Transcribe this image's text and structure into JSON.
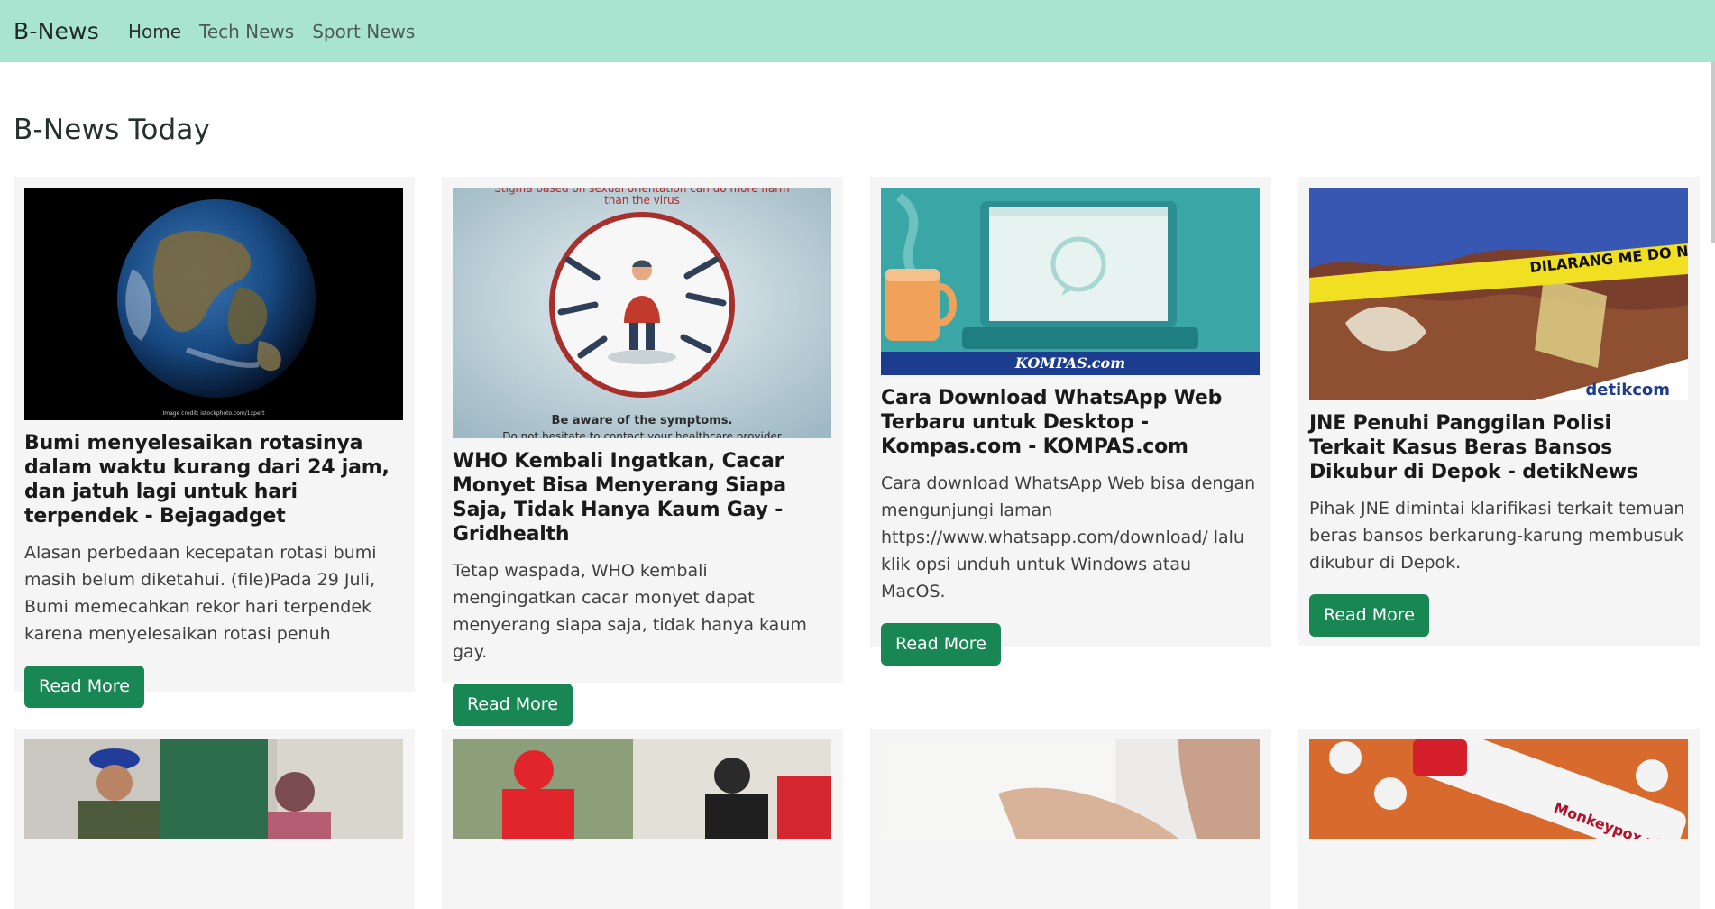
{
  "nav": {
    "brand": "B-News",
    "links": [
      "Home",
      "Tech News",
      "Sport News"
    ]
  },
  "heading": "B-News Today",
  "articles": [
    {
      "title": "Bumi menyelesaikan rotasinya dalam waktu kurang dari 24 jam, dan jatuh lagi untuk hari terpendek - Bejagadget",
      "description": "Alasan perbedaan kecepatan rotasi bumi masih belum diketahui. (file)Pada 29 Juli, Bumi memecahkan rekor hari terpendek karena menyelesaikan rotasi penuh",
      "button": "Read More",
      "image_caption": "Image credit: istockphoto.com/1xpert"
    },
    {
      "title": "WHO Kembali Ingatkan, Cacar Monyet Bisa Menyerang Siapa Saja, Tidak Hanya Kaum Gay - Gridhealth",
      "description": "Tetap waspada, WHO kembali mengingatkan cacar monyet dapat menyerang siapa saja, tidak hanya kaum gay.",
      "button": "Read More",
      "image_top_text": "Stigma based on sexual orientation can do more harm than the virus",
      "image_bottom_text": "Be aware of the symptoms.",
      "image_bottom_text2": "Do not hesitate to contact your healthcare provider"
    },
    {
      "title": "Cara Download WhatsApp Web Terbaru untuk Desktop - Kompas.com - KOMPAS.com",
      "description": "Cara download WhatsApp Web bisa dengan mengunjungi laman https://www.whatsapp.com/download/ lalu klik opsi unduh untuk Windows atau MacOS.",
      "button": "Read More",
      "image_logo": "KOMPAS.com"
    },
    {
      "title": "JNE Penuhi Panggilan Polisi Terkait Kasus Beras Bansos Dikubur di Depok - detikNews",
      "description": "Pihak JNE dimintai klarifikasi terkait temuan beras bansos berkarung-karung membusuk dikubur di Depok.",
      "button": "Read More",
      "image_tape": "DILARANG ME  DO NOT CR",
      "image_logo": "detikcom"
    }
  ],
  "colors": {
    "navbar": "#a8e4d0",
    "button": "#198754",
    "card": "#f5f5f5"
  }
}
